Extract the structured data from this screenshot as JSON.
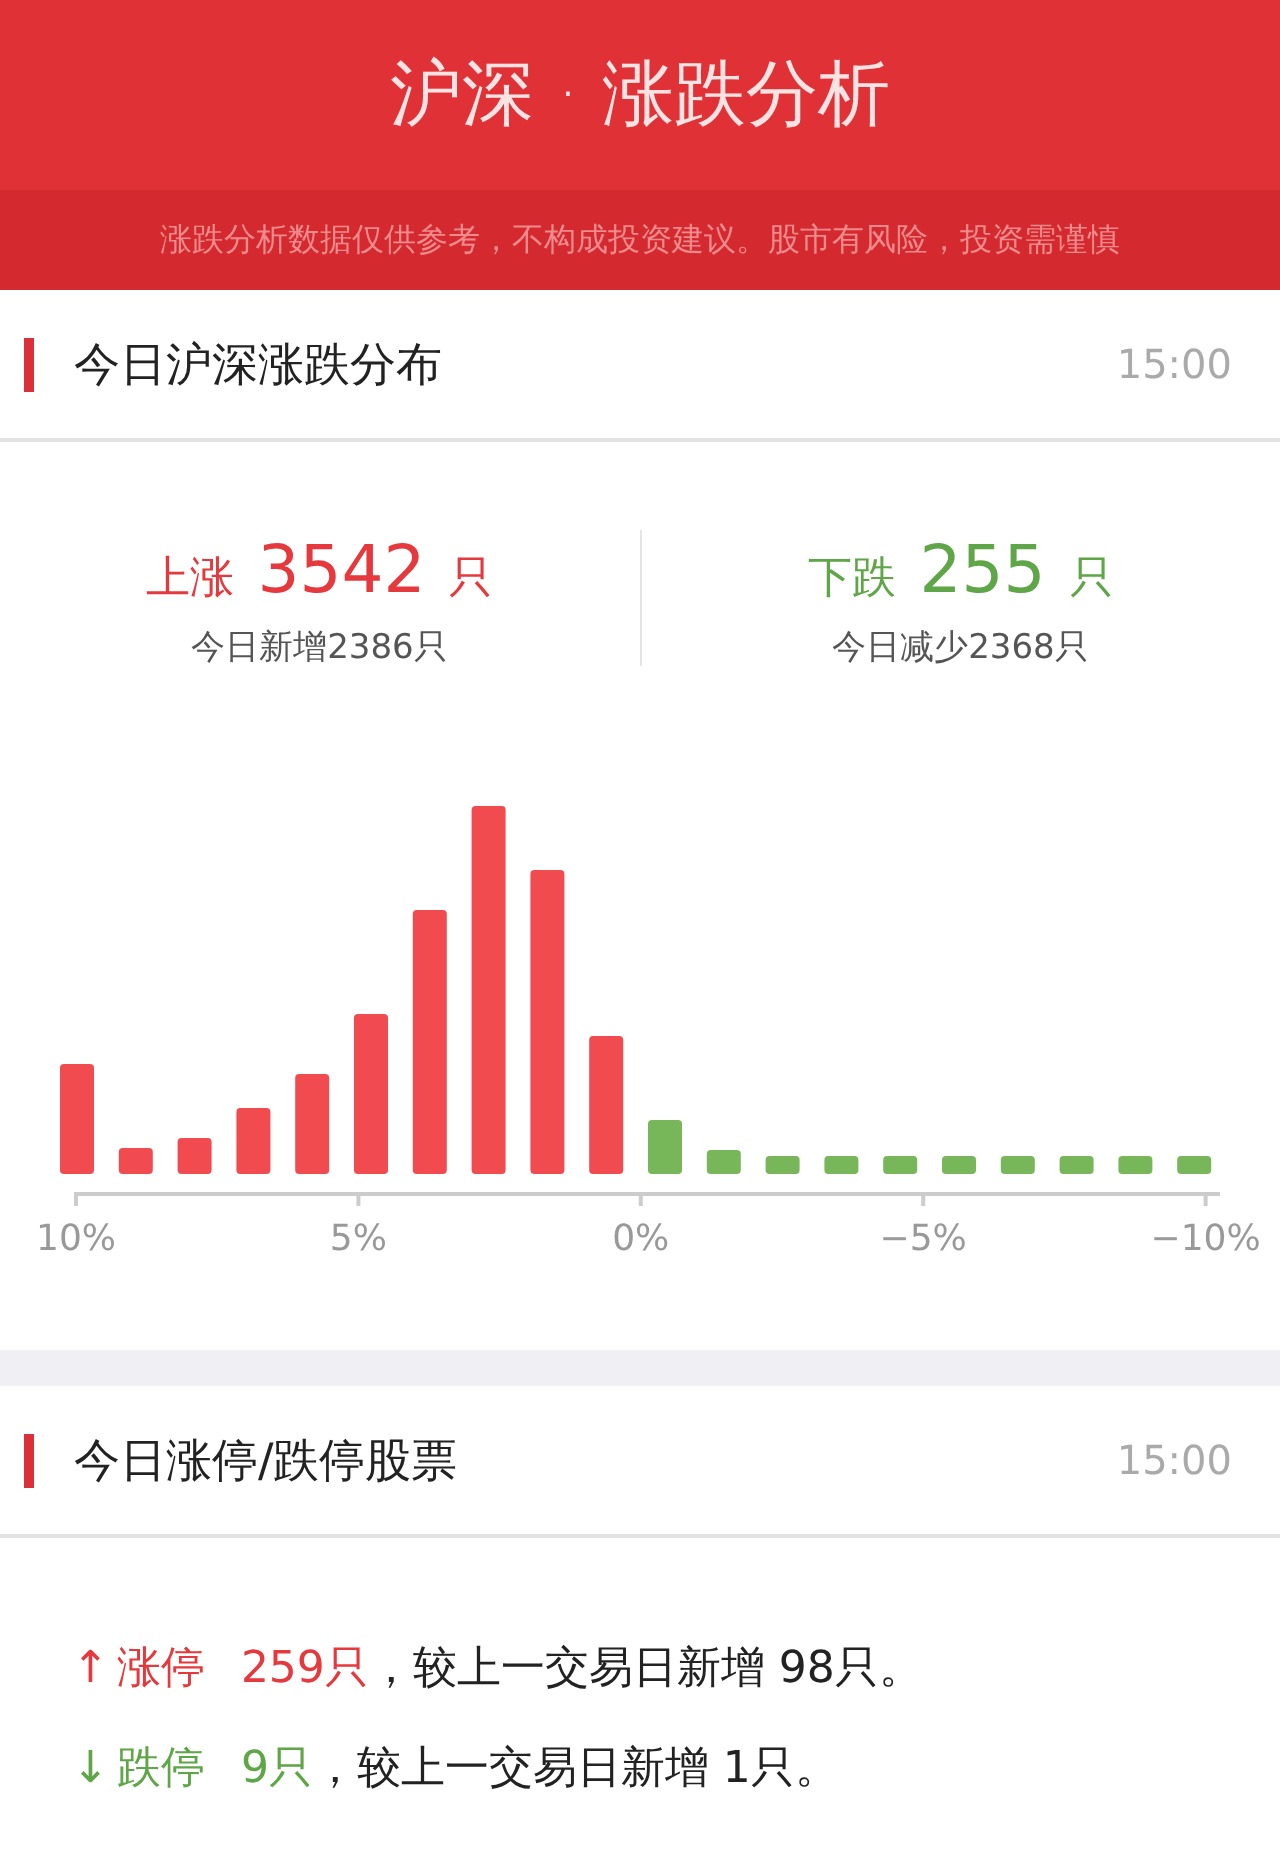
{
  "header": {
    "title": "沪深 · 涨跌分析",
    "disclaimer": "涨跌分析数据仅供参考，不构成投资建议。股市有风险，投资需谨慎"
  },
  "distribution": {
    "title": "今日沪深涨跌分布",
    "time": "15:00",
    "stats": [
      {
        "kind": "up",
        "label": "上涨",
        "count": "3542",
        "unit": "只",
        "change": "今日新增2386只"
      },
      {
        "kind": "down",
        "label": "下跌",
        "count": "255",
        "unit": "只",
        "change": "今日减少2368只"
      }
    ],
    "axis_labels": [
      "10%",
      "5%",
      "0%",
      "−5%",
      "−10%"
    ]
  },
  "limits": {
    "title": "今日涨停/跌停股票",
    "time": "15:00",
    "rows": [
      {
        "kind": "up",
        "arrow": "↑",
        "label": "涨停",
        "count": "259只",
        "text": "，较上一交易日新增 98只。"
      },
      {
        "kind": "down",
        "arrow": "↓",
        "label": "跌停",
        "count": "9只",
        "text": "，较上一交易日新增 1只。"
      }
    ]
  }
}
